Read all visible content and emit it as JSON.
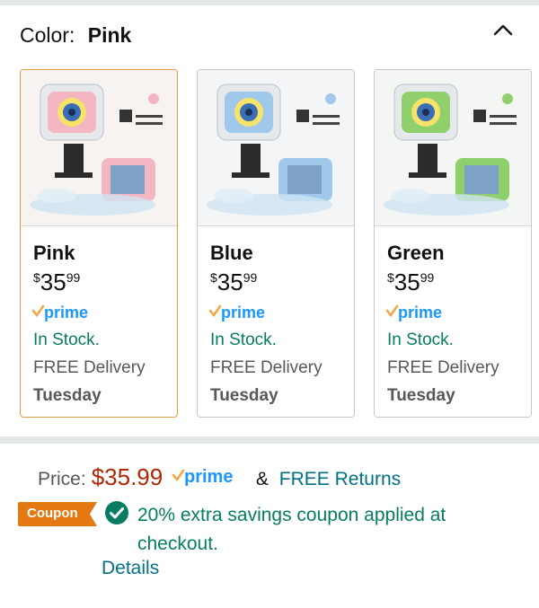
{
  "color_selector": {
    "label": "Color:",
    "selected": "Pink"
  },
  "variants": [
    {
      "name": "Pink",
      "currency": "$",
      "price_whole": "35",
      "price_fraction": "99",
      "prime": "prime",
      "stock": "In Stock.",
      "delivery": "FREE Delivery",
      "delivery_day": "Tuesday",
      "accent": "#f4b6c2",
      "selected": true
    },
    {
      "name": "Blue",
      "currency": "$",
      "price_whole": "35",
      "price_fraction": "99",
      "prime": "prime",
      "stock": "In Stock.",
      "delivery": "FREE Delivery",
      "delivery_day": "Tuesday",
      "accent": "#9fc8ea",
      "selected": false
    },
    {
      "name": "Green",
      "currency": "$",
      "price_whole": "35",
      "price_fraction": "99",
      "prime": "prime",
      "stock": "In Stock.",
      "delivery": "FREE Delivery",
      "delivery_day": "Tuesday",
      "accent": "#8fd06c",
      "selected": false
    }
  ],
  "price_section": {
    "label": "Price:",
    "amount": "$35.99",
    "prime": "prime",
    "amp": "&",
    "returns": "FREE Returns"
  },
  "coupon": {
    "badge": "Coupon",
    "text": "20% extra savings coupon applied at checkout.",
    "details_link": "Details"
  },
  "colors": {
    "prime_blue": "#1a98ff",
    "prime_check": "#f3a847",
    "in_stock": "#067d62",
    "price_red": "#b12704",
    "link": "#007185",
    "coupon_orange": "#e47911",
    "selected_border": "#e49c4a"
  }
}
